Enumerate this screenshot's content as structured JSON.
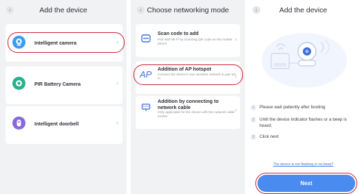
{
  "panel1": {
    "title": "Add the device",
    "back_icon": "chevron-left-icon",
    "devices": [
      {
        "label": "Intelligent camera",
        "icon": "camera-icon",
        "color": "#3d9be9"
      },
      {
        "label": "PIR Battery Camera",
        "icon": "battery-camera-icon",
        "color": "#29b18f"
      },
      {
        "label": "Intelligent doorbell",
        "icon": "doorbell-icon",
        "color": "#8b6ad8"
      }
    ]
  },
  "panel2": {
    "title": "Choose networking mode",
    "options": [
      {
        "title": "Scan code to add",
        "desc": "Pair with Wi-Fi by scanning QR code on the mobile phone",
        "icon": "scan-icon"
      },
      {
        "title": "Addition of AP hotspot",
        "desc": "Connect the device's own wireless network to pair Wi-Fi",
        "icon": "ap-icon",
        "icon_text": "AP"
      },
      {
        "title": "Addition by connecting to network cable",
        "desc": "Only applicable for the device with the network cable socket",
        "icon": "ethernet-icon"
      }
    ]
  },
  "panel3": {
    "title": "Add the device",
    "steps": [
      {
        "num": "1",
        "text": "Please wait patiently after booting"
      },
      {
        "num": "2",
        "text": "Until the device indicator flashes or a beep is heard;"
      },
      {
        "num": "3",
        "text": "Click next"
      }
    ],
    "help_link": "The device is not flashing or no beep?",
    "next_label": "Next"
  },
  "colors": {
    "accent": "#4a8bf0",
    "highlight": "#c8202f"
  }
}
